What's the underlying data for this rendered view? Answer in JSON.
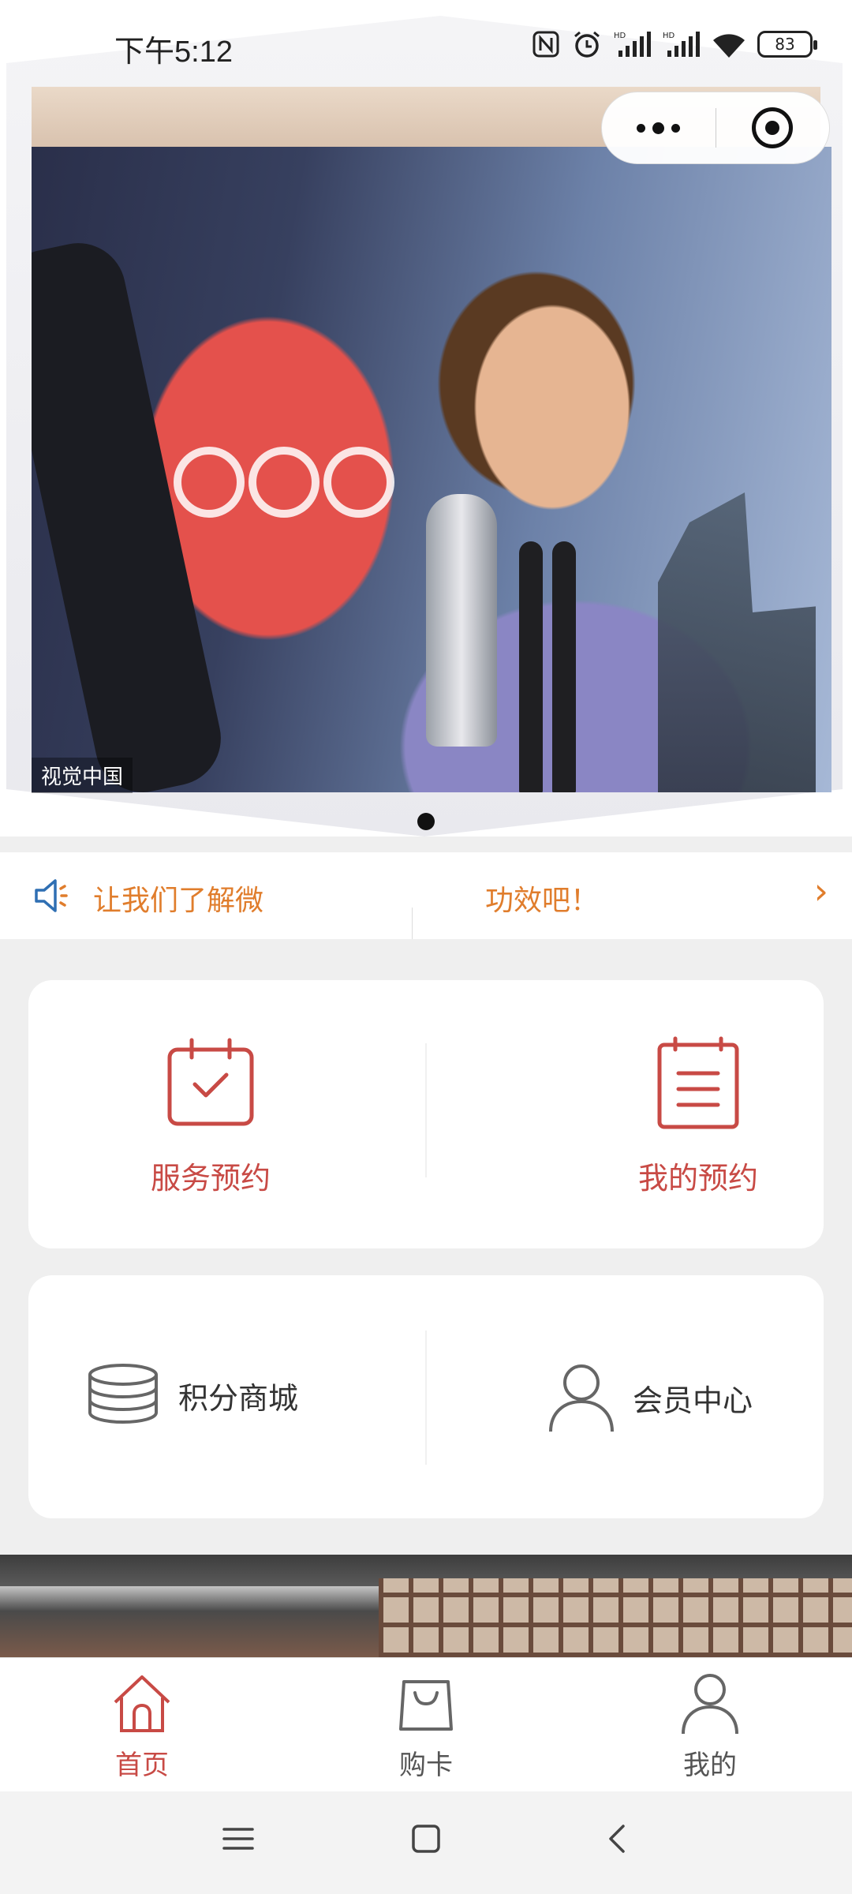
{
  "status_bar": {
    "time": "下午5:12",
    "battery": "83",
    "icons": [
      "nfc-icon",
      "alarm-icon",
      "signal-hd-icon",
      "signal-hd-icon",
      "wifi-icon",
      "battery-icon"
    ]
  },
  "capsule": {
    "more_icon": "more-dots-icon",
    "close_icon": "target-close-icon"
  },
  "banner": {
    "image_credit": "视觉中国",
    "active_slide": 1
  },
  "notice": {
    "icon": "speaker-icon",
    "text_left": "让我们了解微",
    "text_right": "功效吧！",
    "arrow_icon": "chevron-right-icon"
  },
  "services": {
    "items": [
      {
        "label": "服务预约",
        "icon": "calendar-check-icon"
      },
      {
        "label": "我的预约",
        "icon": "clipboard-list-icon"
      }
    ]
  },
  "shortcuts": {
    "items": [
      {
        "label": "积分商城",
        "icon": "coins-stack-icon"
      },
      {
        "label": "会员中心",
        "icon": "user-icon"
      }
    ]
  },
  "tabbar": {
    "items": [
      {
        "label": "首页",
        "icon": "home-icon",
        "active": true
      },
      {
        "label": "购卡",
        "icon": "shopping-bag-icon",
        "active": false
      },
      {
        "label": "我的",
        "icon": "user-icon",
        "active": false
      }
    ],
    "active_color": "#c84a45"
  },
  "colors": {
    "accent": "#c84a45",
    "notice": "#e07d2c",
    "background": "#efefef"
  }
}
